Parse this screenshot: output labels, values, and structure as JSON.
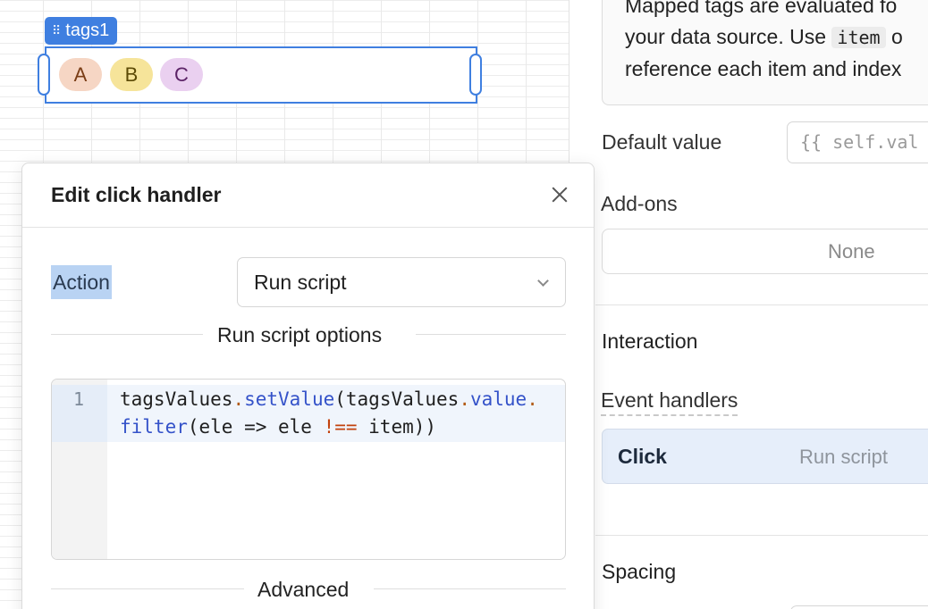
{
  "canvas": {
    "component_label": "tags1",
    "tags": [
      {
        "label": "A",
        "bg": "#f6d6c4",
        "fg": "#7a3d16"
      },
      {
        "label": "B",
        "bg": "#f6e49a",
        "fg": "#5c4a06"
      },
      {
        "label": "C",
        "bg": "#ead0f0",
        "fg": "#5b2266"
      }
    ]
  },
  "inspector": {
    "info_lines": [
      "Mapped tags are evaluated fo",
      "your data source. Use",
      "reference each item and index"
    ],
    "info_code": "item",
    "info_tail": "o",
    "default_value_label": "Default value",
    "default_value_placeholder": "{{ self.val",
    "addons_label": "Add-ons",
    "addons_value": "None",
    "interaction_title": "Interaction",
    "event_handlers_label": "Event handlers",
    "handler": {
      "event": "Click",
      "action": "Run script"
    },
    "spacing_title": "Spacing"
  },
  "modal": {
    "title": "Edit click handler",
    "action_label": "Action",
    "action_value": "Run script",
    "options_title": "Run script options",
    "line_number": "1",
    "code": {
      "l1_a": "tagsValues",
      "l1_dot1": ".",
      "l1_m1": "setValue",
      "l1_b": "(tagsValues",
      "l1_dot2": ".",
      "l1_m2": "value",
      "l1_dot3": ".",
      "l2_m1": "filter",
      "l2_a": "(ele => ele ",
      "l2_op": "!==",
      "l2_b": " item))"
    },
    "advanced_title": "Advanced"
  },
  "colors": {
    "accent": "#3f7fe0",
    "selection": "#b9d3f3",
    "handler_bg": "#e6eefa"
  }
}
